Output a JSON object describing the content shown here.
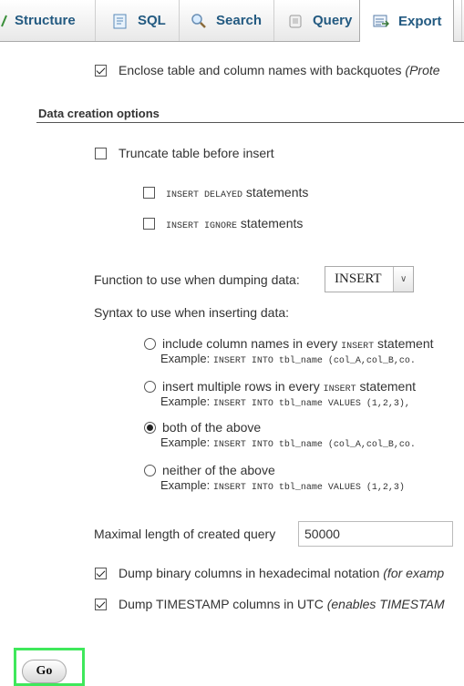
{
  "tabs": [
    {
      "label": "Structure",
      "icon": "structure-icon"
    },
    {
      "label": "SQL",
      "icon": "sql-icon"
    },
    {
      "label": "Search",
      "icon": "search-icon"
    },
    {
      "label": "Query",
      "icon": "query-icon"
    },
    {
      "label": "Export",
      "icon": "export-icon",
      "active": true
    }
  ],
  "options": {
    "enclose_label": "Enclose table and column names with backquotes ",
    "enclose_note": "(Prote",
    "enclose_checked": true
  },
  "data_creation": {
    "title": "Data creation options",
    "truncate_label": "Truncate table before insert",
    "insert_delayed_code": "INSERT DELAYED",
    "insert_delayed_suffix": " statements",
    "insert_ignore_code": "INSERT IGNORE",
    "insert_ignore_suffix": " statements",
    "function_label": "Function to use when dumping data:",
    "function_value": "INSERT",
    "syntax_label": "Syntax to use when inserting data:",
    "syntax_options": [
      {
        "label": "include column names in every ",
        "code": "INSERT",
        "suffix": " statement",
        "example_prefix": "Example: ",
        "example_code": "INSERT INTO tbl_name (col_A,col_B,co.",
        "selected": false
      },
      {
        "label": "insert multiple rows in every ",
        "code": "INSERT",
        "suffix": " statement",
        "example_prefix": "Example: ",
        "example_code": "INSERT INTO tbl_name VALUES (1,2,3),",
        "selected": false
      },
      {
        "label": "both of the above",
        "code": "",
        "suffix": "",
        "example_prefix": "Example: ",
        "example_code": "INSERT INTO tbl_name (col_A,col_B,co.",
        "selected": true
      },
      {
        "label": "neither of the above",
        "code": "",
        "suffix": "",
        "example_prefix": "Example: ",
        "example_code": "INSERT INTO tbl_name VALUES (1,2,3)",
        "selected": false
      }
    ],
    "max_length_label": "Maximal length of created query",
    "max_length_value": "50000",
    "dump_binary_label": "Dump binary columns in hexadecimal notation ",
    "dump_binary_note": "(for examp",
    "dump_timestamp_label": "Dump TIMESTAMP columns in UTC ",
    "dump_timestamp_note": "(enables TIMESTAM"
  },
  "go_label": "Go"
}
